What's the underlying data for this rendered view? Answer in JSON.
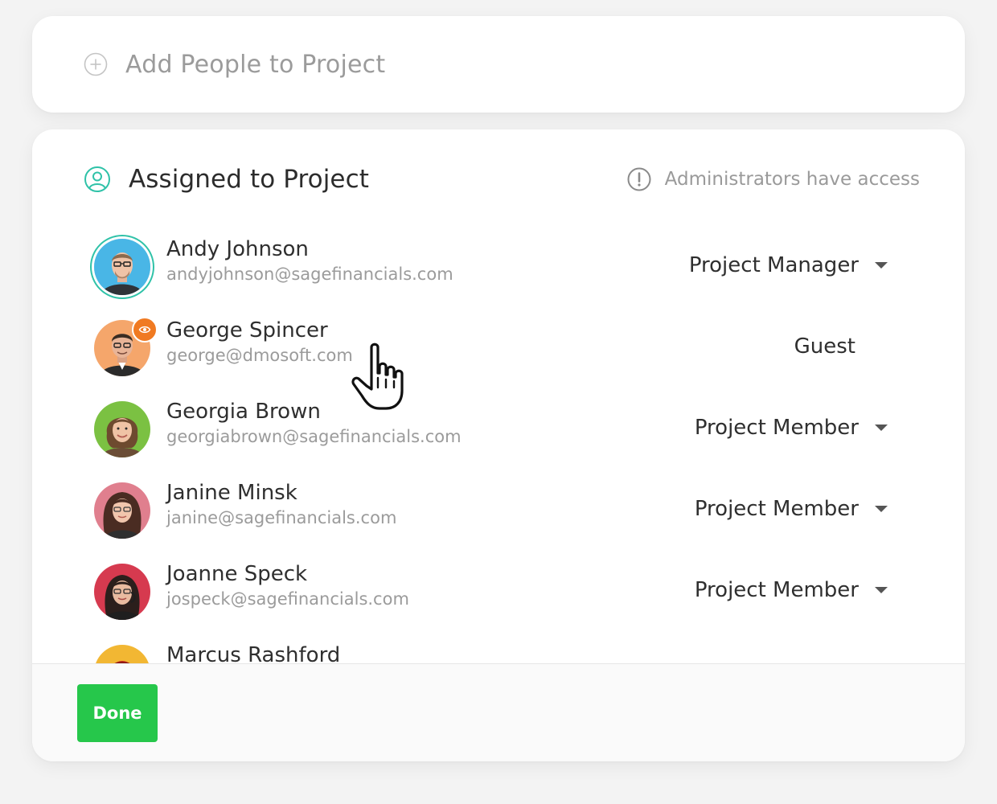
{
  "add_section": {
    "label": "Add People to Project",
    "icon": "plus-circle-icon"
  },
  "assigned_section": {
    "title": "Assigned to Project",
    "icon": "user-circle-icon",
    "note": "Administrators have access",
    "note_icon": "alert-circle-icon"
  },
  "people": [
    {
      "name": "Andy Johnson",
      "email": "andyjohnson@sagefinancials.com",
      "role": "Project Manager",
      "has_dropdown": true,
      "selected": true
    },
    {
      "name": "George Spincer",
      "email": "george@dmosoft.com",
      "role": "Guest",
      "has_dropdown": false,
      "badge": "eye-icon"
    },
    {
      "name": "Georgia Brown",
      "email": "georgiabrown@sagefinancials.com",
      "role": "Project Member",
      "has_dropdown": true
    },
    {
      "name": "Janine Minsk",
      "email": "janine@sagefinancials.com",
      "role": "Project Member",
      "has_dropdown": true
    },
    {
      "name": "Joanne Speck",
      "email": "jospeck@sagefinancials.com",
      "role": "Project Member",
      "has_dropdown": true
    },
    {
      "name": "Marcus Rashford",
      "email": "",
      "role": "",
      "has_dropdown": false
    }
  ],
  "footer": {
    "done_label": "Done"
  },
  "colors": {
    "accent_teal": "#2fc2a8",
    "done_green": "#26c74b",
    "guest_badge_orange": "#f07a22"
  }
}
